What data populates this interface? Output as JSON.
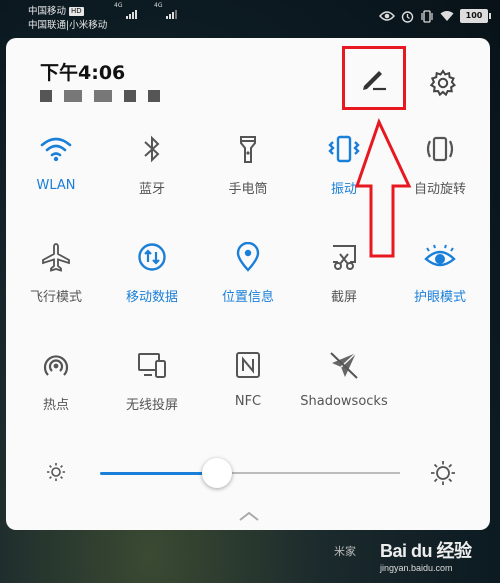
{
  "statusbar": {
    "carrier1": "中国移动",
    "carrier1_badge": "HD",
    "carrier2": "中国联通|小米移动",
    "net1": "4G",
    "net2": "4G",
    "battery": "100"
  },
  "panel": {
    "time": "下午4:06"
  },
  "tiles": [
    {
      "label": "WLAN",
      "icon": "wifi-icon",
      "on": true
    },
    {
      "label": "蓝牙",
      "icon": "bluetooth-icon",
      "on": false
    },
    {
      "label": "手电筒",
      "icon": "flashlight-icon",
      "on": false
    },
    {
      "label": "振动",
      "icon": "vibrate-icon",
      "on": true
    },
    {
      "label": "自动旋转",
      "icon": "auto-rotate-icon",
      "on": false
    },
    {
      "label": "飞行模式",
      "icon": "airplane-icon",
      "on": false
    },
    {
      "label": "移动数据",
      "icon": "mobile-data-icon",
      "on": true
    },
    {
      "label": "位置信息",
      "icon": "location-icon",
      "on": true
    },
    {
      "label": "截屏",
      "icon": "screenshot-icon",
      "on": false
    },
    {
      "label": "护眼模式",
      "icon": "eye-comfort-icon",
      "on": true
    },
    {
      "label": "热点",
      "icon": "hotspot-icon",
      "on": false
    },
    {
      "label": "无线投屏",
      "icon": "wireless-projection-icon",
      "on": false
    },
    {
      "label": "NFC",
      "icon": "nfc-icon",
      "on": false
    },
    {
      "label": "Shadowsocks",
      "icon": "shadowsocks-icon",
      "on": false
    }
  ],
  "brightness": {
    "level": 0.4
  },
  "colors": {
    "accent": "#1a7fd8",
    "annotation": "#e81820",
    "inactive": "#555555"
  },
  "footer": {
    "left": "米家"
  },
  "watermark": {
    "logo": "Bai du 经验",
    "sub": "jingyan.baidu.com"
  }
}
